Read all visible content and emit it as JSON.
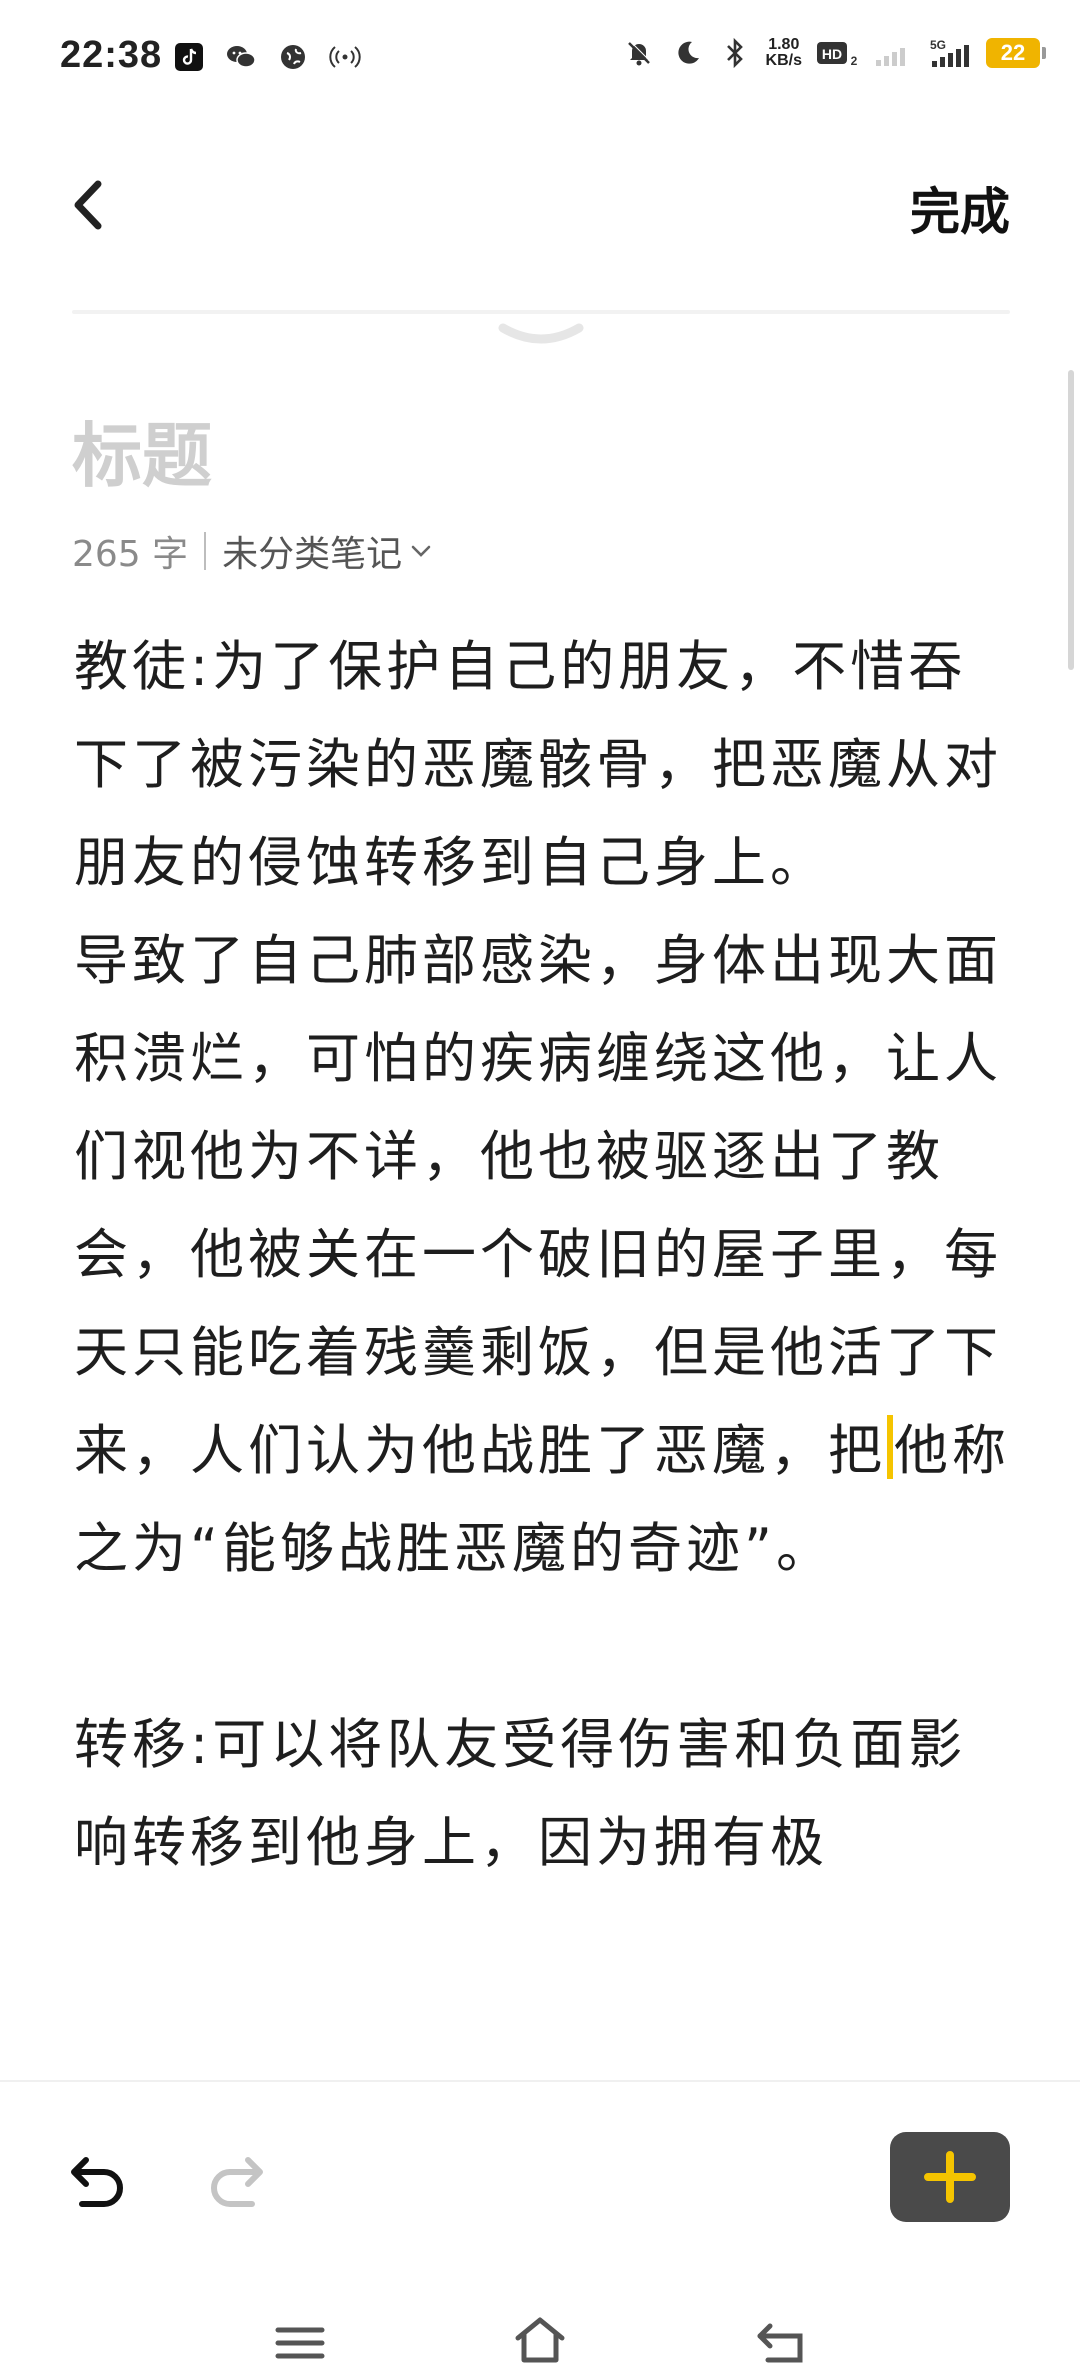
{
  "status_bar": {
    "time": "22:38",
    "speed_top": "1.80",
    "speed_bottom": "KB/s",
    "hd_label": "HD",
    "network_label": "5G",
    "battery": "22"
  },
  "header": {
    "done_label": "完成"
  },
  "note": {
    "title_placeholder": "标题",
    "word_count": "265 字",
    "category": "未分类笔记",
    "paragraphs": [
      "教徒:为了保护自己的朋友，不惜吞下了被污染的恶魔骸骨，把恶魔从对朋友的侵蚀转移到自己身上。",
      "导致了自己肺部感染，身体出现大面积溃烂，可怕的疾病缠绕这他，让人们视他为不详，他也被驱逐出了教会，他被关在一个破旧的屋子里，每天只能吃着残羹剩饭，但是他活了下来，人们认为他战胜了恶魔，把",
      "他称之为“能够战胜恶魔的奇迹”。",
      "转移:可以将队友受得伤害和负面影响转移到他身上，因为拥有极"
    ]
  },
  "colors": {
    "accent_cursor": "#f5c400",
    "add_button_bg": "#4a4a4a",
    "add_button_icon": "#f5c400"
  }
}
